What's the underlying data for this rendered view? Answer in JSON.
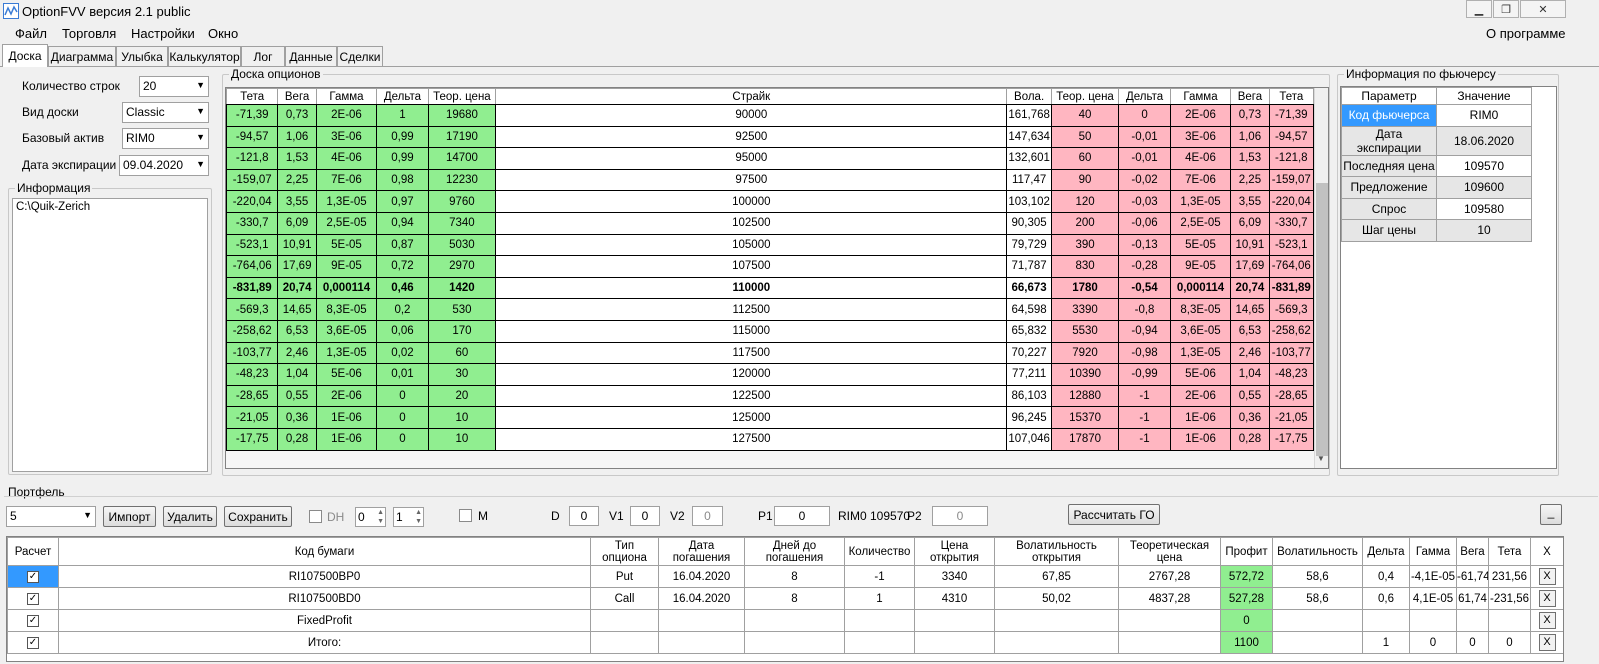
{
  "window": {
    "title": "OptionFVV версия 2.1 public"
  },
  "menu": {
    "items": [
      "Файл",
      "Торговля",
      "Настройки",
      "Окно"
    ],
    "about": "О программе"
  },
  "tabs": [
    "Доска",
    "Диаграмма",
    "Улыбка",
    "Калькулятор",
    "Лог",
    "Данные",
    "Сделки"
  ],
  "settings": {
    "rows_label": "Количество строк",
    "rows_value": "20",
    "board_label": "Вид доски",
    "board_value": "Classic",
    "asset_label": "Базовый актив",
    "asset_value": "RIM0",
    "expiry_label": "Дата экспирации",
    "expiry_value": "09.04.2020",
    "info_title": "Информация",
    "info_text": "C:\\Quik-Zerich"
  },
  "board": {
    "title": "Доска опционов",
    "headers": [
      "Тета",
      "Вега",
      "Гамма",
      "Дельта",
      "Теор. цена",
      "Страйк",
      "Вола.",
      "Теор. цена",
      "Дельта",
      "Гамма",
      "Вега",
      "Тета"
    ],
    "rows": [
      [
        "-71,39",
        "0,73",
        "2E-06",
        "1",
        "19680",
        "90000",
        "161,768",
        "40",
        "0",
        "2E-06",
        "0,73",
        "-71,39"
      ],
      [
        "-94,57",
        "1,06",
        "3E-06",
        "0,99",
        "17190",
        "92500",
        "147,634",
        "50",
        "-0,01",
        "3E-06",
        "1,06",
        "-94,57"
      ],
      [
        "-121,8",
        "1,53",
        "4E-06",
        "0,99",
        "14700",
        "95000",
        "132,601",
        "60",
        "-0,01",
        "4E-06",
        "1,53",
        "-121,8"
      ],
      [
        "-159,07",
        "2,25",
        "7E-06",
        "0,98",
        "12230",
        "97500",
        "117,47",
        "90",
        "-0,02",
        "7E-06",
        "2,25",
        "-159,07"
      ],
      [
        "-220,04",
        "3,55",
        "1,3E-05",
        "0,97",
        "9760",
        "100000",
        "103,102",
        "120",
        "-0,03",
        "1,3E-05",
        "3,55",
        "-220,04"
      ],
      [
        "-330,7",
        "6,09",
        "2,5E-05",
        "0,94",
        "7340",
        "102500",
        "90,305",
        "200",
        "-0,06",
        "2,5E-05",
        "6,09",
        "-330,7"
      ],
      [
        "-523,1",
        "10,91",
        "5E-05",
        "0,87",
        "5030",
        "105000",
        "79,729",
        "390",
        "-0,13",
        "5E-05",
        "10,91",
        "-523,1"
      ],
      [
        "-764,06",
        "17,69",
        "9E-05",
        "0,72",
        "2970",
        "107500",
        "71,787",
        "830",
        "-0,28",
        "9E-05",
        "17,69",
        "-764,06"
      ],
      [
        "-831,89",
        "20,74",
        "0,000114",
        "0,46",
        "1420",
        "110000",
        "66,673",
        "1780",
        "-0,54",
        "0,000114",
        "20,74",
        "-831,89"
      ],
      [
        "-569,3",
        "14,65",
        "8,3E-05",
        "0,2",
        "530",
        "112500",
        "64,598",
        "3390",
        "-0,8",
        "8,3E-05",
        "14,65",
        "-569,3"
      ],
      [
        "-258,62",
        "6,53",
        "3,6E-05",
        "0,06",
        "170",
        "115000",
        "65,832",
        "5530",
        "-0,94",
        "3,6E-05",
        "6,53",
        "-258,62"
      ],
      [
        "-103,77",
        "2,46",
        "1,3E-05",
        "0,02",
        "60",
        "117500",
        "70,227",
        "7920",
        "-0,98",
        "1,3E-05",
        "2,46",
        "-103,77"
      ],
      [
        "-48,23",
        "1,04",
        "5E-06",
        "0,01",
        "30",
        "120000",
        "77,211",
        "10390",
        "-0,99",
        "5E-06",
        "1,04",
        "-48,23"
      ],
      [
        "-28,65",
        "0,55",
        "2E-06",
        "0",
        "20",
        "122500",
        "86,103",
        "12880",
        "-1",
        "2E-06",
        "0,55",
        "-28,65"
      ],
      [
        "-21,05",
        "0,36",
        "1E-06",
        "0",
        "10",
        "125000",
        "96,245",
        "15370",
        "-1",
        "1E-06",
        "0,36",
        "-21,05"
      ],
      [
        "-17,75",
        "0,28",
        "1E-06",
        "0",
        "10",
        "127500",
        "107,046",
        "17870",
        "-1",
        "1E-06",
        "0,28",
        "-17,75"
      ]
    ],
    "bold_row_index": 8
  },
  "futures": {
    "title": "Информация по фьючерсу",
    "headers": [
      "Параметр",
      "Значение"
    ],
    "rows": [
      [
        "Код фьючерса",
        "RIM0"
      ],
      [
        "Дата экспирации",
        "18.06.2020"
      ],
      [
        "Последняя цена",
        "109570"
      ],
      [
        "Предложение",
        "109600"
      ],
      [
        "Спрос",
        "109580"
      ],
      [
        "Шаг цены",
        "10"
      ]
    ]
  },
  "portfolio": {
    "title": "Портфель",
    "selector_value": "5",
    "import": "Импорт",
    "delete": "Удалить",
    "save": "Сохранить",
    "dh_label": "DH",
    "dh_val1": "0",
    "dh_val2": "1",
    "m_label": "M",
    "d_label": "D",
    "d_value": "0",
    "v1_label": "V1",
    "v1_value": "0",
    "v2_label": "V2",
    "v2_value": "0",
    "p1_label": "P1",
    "p1_value": "0",
    "asset_price": "RIM0 109570",
    "p2_label": "P2",
    "p2_value": "0",
    "calc_button": "Рассчитать ГО",
    "collapse_button": "_",
    "headers": [
      "Расчет",
      "Код бумаги",
      "Тип опциона",
      "Дата погашения",
      "Дней до погашения",
      "Количество",
      "Цена открытия",
      "Волатильность открытия",
      "Теоретическая цена",
      "Профит",
      "Волатильность",
      "Дельта",
      "Гамма",
      "Вега",
      "Тета",
      "X"
    ],
    "rows": [
      {
        "check": "✓",
        "code": "RI107500BP0",
        "type": "Put",
        "date": "16.04.2020",
        "days": "8",
        "qty": "-1",
        "open": "3340",
        "vol_open": "67,85",
        "theor": "2767,28",
        "profit": "572,72",
        "vol": "58,6",
        "delta": "0,4",
        "gamma": "-4,1E-05",
        "vega": "-61,74",
        "theta": "231,56",
        "x": "X"
      },
      {
        "check": "✓",
        "code": "RI107500BD0",
        "type": "Call",
        "date": "16.04.2020",
        "days": "8",
        "qty": "1",
        "open": "4310",
        "vol_open": "50,02",
        "theor": "4837,28",
        "profit": "527,28",
        "vol": "58,6",
        "delta": "0,6",
        "gamma": "4,1E-05",
        "vega": "61,74",
        "theta": "-231,56",
        "x": "X"
      },
      {
        "check": "✓",
        "code": "FixedProfit",
        "type": "",
        "date": "",
        "days": "",
        "qty": "",
        "open": "",
        "vol_open": "",
        "theor": "",
        "profit": "0",
        "vol": "",
        "delta": "",
        "gamma": "",
        "vega": "",
        "theta": "",
        "x": "X"
      },
      {
        "check": "✓",
        "code": "Итого:",
        "type": "",
        "date": "",
        "days": "",
        "qty": "",
        "open": "",
        "vol_open": "",
        "theor": "",
        "profit": "1100",
        "vol": "",
        "delta": "1",
        "gamma": "0",
        "vega": "0",
        "theta": "0",
        "x": "X"
      }
    ]
  },
  "colors": {
    "call_side": "#90ee90",
    "put_side": "#ffb6c1",
    "selected": "#3399ff"
  }
}
